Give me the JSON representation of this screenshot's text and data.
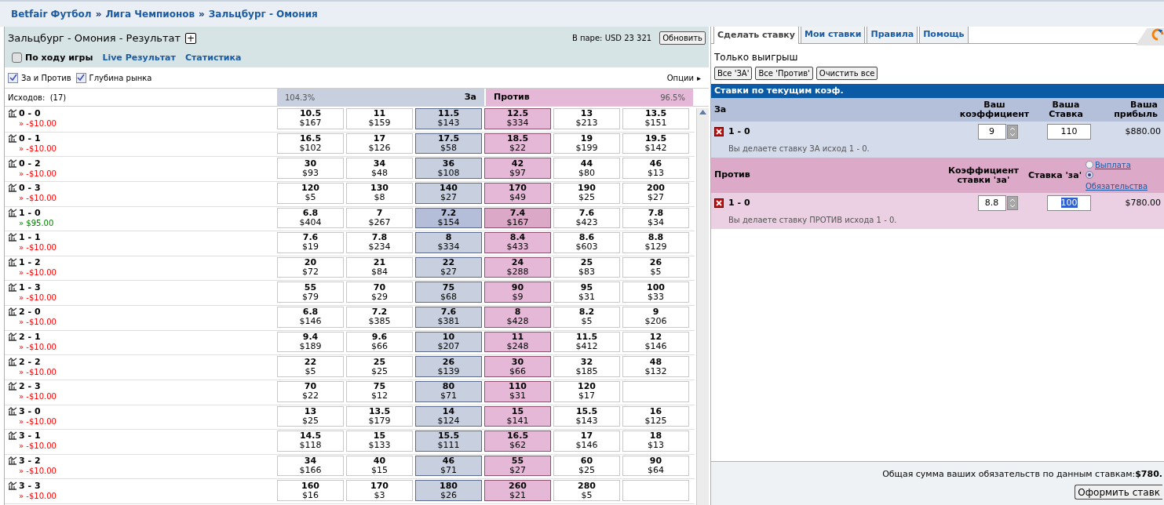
{
  "breadcrumb": [
    {
      "label": "Betfair Футбол"
    },
    {
      "label": "Лига Чемпионов"
    },
    {
      "label": "Зальцбург - Омония"
    }
  ],
  "breadcrumb_separator": "»",
  "market": {
    "title": "Зальцбург - Омония - Результат",
    "expand_button": "+",
    "matched": "В паре: USD 23 321",
    "refresh_button": "Обновить",
    "in_play": {
      "label": "По ходу игры",
      "checked": false
    },
    "links": [
      "Live Результат",
      "Статистика"
    ],
    "view_options": [
      {
        "label": "За и Против",
        "checked": true
      },
      {
        "label": "Глубина рынка",
        "checked": true
      }
    ],
    "options_label": "Опции",
    "options_arrow": "▸"
  },
  "header": {
    "count": "Исходов:  (17)",
    "back_pct": "104.3%",
    "back_label": "За",
    "lay_label": "Против",
    "lay_pct": "96.5%"
  },
  "pl_prefix": "»",
  "runners": [
    {
      "name": "0 - 0",
      "pl": "-$10.00",
      "kind": "loss",
      "selected": false,
      "prices": [
        [
          "10.5",
          "$167"
        ],
        [
          "11",
          "$159"
        ],
        [
          "11.5",
          "$143"
        ],
        [
          "12.5",
          "$334"
        ],
        [
          "13",
          "$213"
        ],
        [
          "13.5",
          "$151"
        ]
      ]
    },
    {
      "name": "0 - 1",
      "pl": "-$10.00",
      "kind": "loss",
      "selected": false,
      "prices": [
        [
          "16.5",
          "$102"
        ],
        [
          "17",
          "$126"
        ],
        [
          "17.5",
          "$58"
        ],
        [
          "18.5",
          "$22"
        ],
        [
          "19",
          "$199"
        ],
        [
          "19.5",
          "$142"
        ]
      ]
    },
    {
      "name": "0 - 2",
      "pl": "-$10.00",
      "kind": "loss",
      "selected": false,
      "prices": [
        [
          "30",
          "$93"
        ],
        [
          "34",
          "$48"
        ],
        [
          "36",
          "$108"
        ],
        [
          "42",
          "$97"
        ],
        [
          "44",
          "$80"
        ],
        [
          "46",
          "$13"
        ]
      ]
    },
    {
      "name": "0 - 3",
      "pl": "-$10.00",
      "kind": "loss",
      "selected": false,
      "prices": [
        [
          "120",
          "$5"
        ],
        [
          "130",
          "$8"
        ],
        [
          "140",
          "$27"
        ],
        [
          "170",
          "$49"
        ],
        [
          "190",
          "$25"
        ],
        [
          "200",
          "$27"
        ]
      ]
    },
    {
      "name": "1 - 0",
      "pl": "$95.00",
      "kind": "profit",
      "selected": true,
      "prices": [
        [
          "6.8",
          "$404"
        ],
        [
          "7",
          "$267"
        ],
        [
          "7.2",
          "$154"
        ],
        [
          "7.4",
          "$167"
        ],
        [
          "7.6",
          "$423"
        ],
        [
          "7.8",
          "$34"
        ]
      ]
    },
    {
      "name": "1 - 1",
      "pl": "-$10.00",
      "kind": "loss",
      "selected": false,
      "prices": [
        [
          "7.6",
          "$19"
        ],
        [
          "7.8",
          "$234"
        ],
        [
          "8",
          "$334"
        ],
        [
          "8.4",
          "$433"
        ],
        [
          "8.6",
          "$603"
        ],
        [
          "8.8",
          "$129"
        ]
      ]
    },
    {
      "name": "1 - 2",
      "pl": "-$10.00",
      "kind": "loss",
      "selected": false,
      "prices": [
        [
          "20",
          "$72"
        ],
        [
          "21",
          "$84"
        ],
        [
          "22",
          "$27"
        ],
        [
          "24",
          "$288"
        ],
        [
          "25",
          "$83"
        ],
        [
          "26",
          "$5"
        ]
      ]
    },
    {
      "name": "1 - 3",
      "pl": "-$10.00",
      "kind": "loss",
      "selected": false,
      "prices": [
        [
          "55",
          "$79"
        ],
        [
          "70",
          "$29"
        ],
        [
          "75",
          "$68"
        ],
        [
          "90",
          "$9"
        ],
        [
          "95",
          "$31"
        ],
        [
          "100",
          "$33"
        ]
      ]
    },
    {
      "name": "2 - 0",
      "pl": "-$10.00",
      "kind": "loss",
      "selected": false,
      "prices": [
        [
          "6.8",
          "$146"
        ],
        [
          "7.2",
          "$385"
        ],
        [
          "7.6",
          "$381"
        ],
        [
          "8",
          "$428"
        ],
        [
          "8.2",
          "$5"
        ],
        [
          "9",
          "$206"
        ]
      ]
    },
    {
      "name": "2 - 1",
      "pl": "-$10.00",
      "kind": "loss",
      "selected": false,
      "prices": [
        [
          "9.4",
          "$189"
        ],
        [
          "9.6",
          "$66"
        ],
        [
          "10",
          "$207"
        ],
        [
          "11",
          "$248"
        ],
        [
          "11.5",
          "$412"
        ],
        [
          "12",
          "$146"
        ]
      ]
    },
    {
      "name": "2 - 2",
      "pl": "-$10.00",
      "kind": "loss",
      "selected": false,
      "prices": [
        [
          "22",
          "$5"
        ],
        [
          "25",
          "$25"
        ],
        [
          "26",
          "$139"
        ],
        [
          "30",
          "$66"
        ],
        [
          "32",
          "$185"
        ],
        [
          "48",
          "$132"
        ]
      ]
    },
    {
      "name": "2 - 3",
      "pl": "-$10.00",
      "kind": "loss",
      "selected": false,
      "prices": [
        [
          "70",
          "$22"
        ],
        [
          "75",
          "$12"
        ],
        [
          "80",
          "$71"
        ],
        [
          "110",
          "$31"
        ],
        [
          "120",
          "$17"
        ]
      ]
    },
    {
      "name": "3 - 0",
      "pl": "-$10.00",
      "kind": "loss",
      "selected": false,
      "prices": [
        [
          "13",
          "$25"
        ],
        [
          "13.5",
          "$179"
        ],
        [
          "14",
          "$124"
        ],
        [
          "15",
          "$141"
        ],
        [
          "15.5",
          "$143"
        ],
        [
          "16",
          "$125"
        ]
      ]
    },
    {
      "name": "3 - 1",
      "pl": "-$10.00",
      "kind": "loss",
      "selected": false,
      "prices": [
        [
          "14.5",
          "$118"
        ],
        [
          "15",
          "$133"
        ],
        [
          "15.5",
          "$111"
        ],
        [
          "16.5",
          "$62"
        ],
        [
          "17",
          "$146"
        ],
        [
          "18",
          "$13"
        ]
      ]
    },
    {
      "name": "3 - 2",
      "pl": "-$10.00",
      "kind": "loss",
      "selected": false,
      "prices": [
        [
          "34",
          "$166"
        ],
        [
          "40",
          "$15"
        ],
        [
          "46",
          "$71"
        ],
        [
          "55",
          "$27"
        ],
        [
          "60",
          "$25"
        ],
        [
          "90",
          "$64"
        ]
      ]
    },
    {
      "name": "3 - 3",
      "pl": "-$10.00",
      "kind": "loss",
      "selected": false,
      "prices": [
        [
          "160",
          "$16"
        ],
        [
          "170",
          "$3"
        ],
        [
          "180",
          "$26"
        ],
        [
          "260",
          "$21"
        ],
        [
          "280",
          "$5"
        ]
      ]
    }
  ],
  "betslip": {
    "tabs": [
      {
        "label": "Сделать ставку",
        "selected": true
      },
      {
        "label": "Мои ставки",
        "selected": false
      },
      {
        "label": "Правила",
        "selected": false
      },
      {
        "label": "Помощь",
        "selected": false
      }
    ],
    "mode": "Только выигрыш",
    "buttons": [
      "Все 'ЗА'",
      "Все 'Против'",
      "Очистить все"
    ],
    "section_title": "Ставки по текущим коэф.",
    "back": {
      "label": "За",
      "columns": [
        "Ваш коэффициент",
        "Ваша Ставка",
        "Ваша прибыль"
      ],
      "bet": {
        "selection": "1 - 0",
        "odds": "9",
        "stake": "110",
        "result": "$880.00",
        "description": "Вы делаете ставку ЗА исход 1 - 0."
      }
    },
    "lay": {
      "label": "Против",
      "columns": [
        "Коэффициент ставки 'за'",
        "Ставка 'за'"
      ],
      "radios": [
        {
          "label": "Выплата",
          "selected": false
        },
        {
          "label": "Обязательства",
          "selected": true
        }
      ],
      "bet": {
        "selection": "1 - 0",
        "odds": "8.8",
        "stake": "100",
        "result": "$780.00",
        "description": "Вы делаете ставку ПРОТИВ исхода 1 - 0."
      }
    },
    "total_label": "Общая сумма ваших обязательств по данным ставкам:",
    "total_value": "$780.",
    "submit_button": "Оформить ставк"
  }
}
